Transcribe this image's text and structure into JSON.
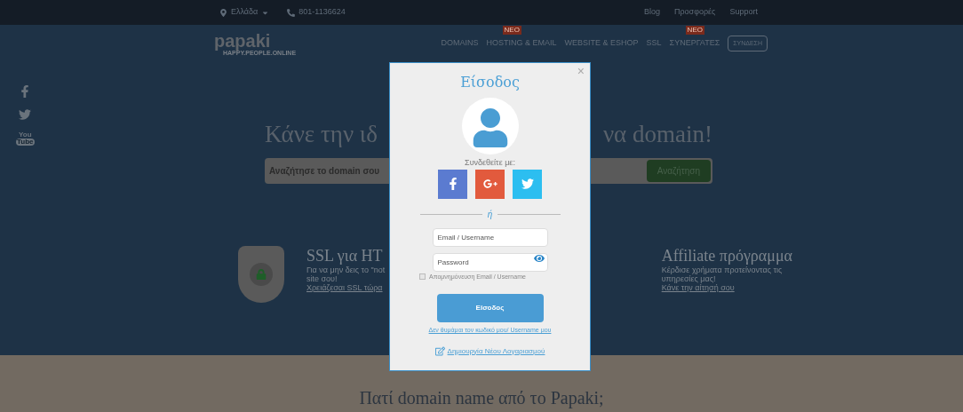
{
  "top_bar": {
    "country": "Ελλάδα",
    "phone": "801-1136624",
    "links": [
      "Blog",
      "Προσφορές",
      "Support"
    ]
  },
  "header": {
    "logo": "papaki",
    "tagline": "HAPPY.PEOPLE.ONLINE",
    "nav": [
      {
        "label": "DOMAINS"
      },
      {
        "label": "HOSTING & EMAIL",
        "badge": "NEO"
      },
      {
        "label": "WEBSITE & ESHOP"
      },
      {
        "label": "SSL"
      },
      {
        "label": "ΣΥΝΕΡΓΑΤΕΣ",
        "badge": "NEO"
      }
    ],
    "login_button": "ΣΥΝΔΕΣΗ"
  },
  "social_sidebar": {
    "youtube_you": "You",
    "youtube_tube": "Tube"
  },
  "hero": {
    "title_left": "Κάνε την ιδ",
    "title_right": "να domain!",
    "search_placeholder": "Αναζήτησε το domain σου",
    "search_button": "Αναζήτηση"
  },
  "features": [
    {
      "title": "SSL για HT",
      "lines": [
        "Για να μην δεις το \"not",
        "site σου!"
      ],
      "link": "Χρειάζεσαι SSL τώρα"
    },
    {
      "title": "Affiliate πρόγραμμα",
      "lines": [
        "Κέρδισε χρήματα προτείνοντας τις",
        "υπηρεσίες μας!"
      ],
      "link": "Κάνε την αίτησή σου"
    }
  ],
  "bottom": {
    "title": "Πατί domain name από το Papaki;"
  },
  "login_modal": {
    "close": "×",
    "title": "Είσοδος",
    "connect_with": "Συνδεθείτε με:",
    "or": "ή",
    "username_placeholder": "Email / Username",
    "password_placeholder": "Password",
    "remember": {
      "label": "Απομνημόνευση Email / Username",
      "checked": false
    },
    "submit": "Είσοδος",
    "forgot": "Δεν θυμάμαι τον κωδικό μου/ Username μου",
    "create": "Δημιουργία Νέου Λογαριασμού"
  }
}
